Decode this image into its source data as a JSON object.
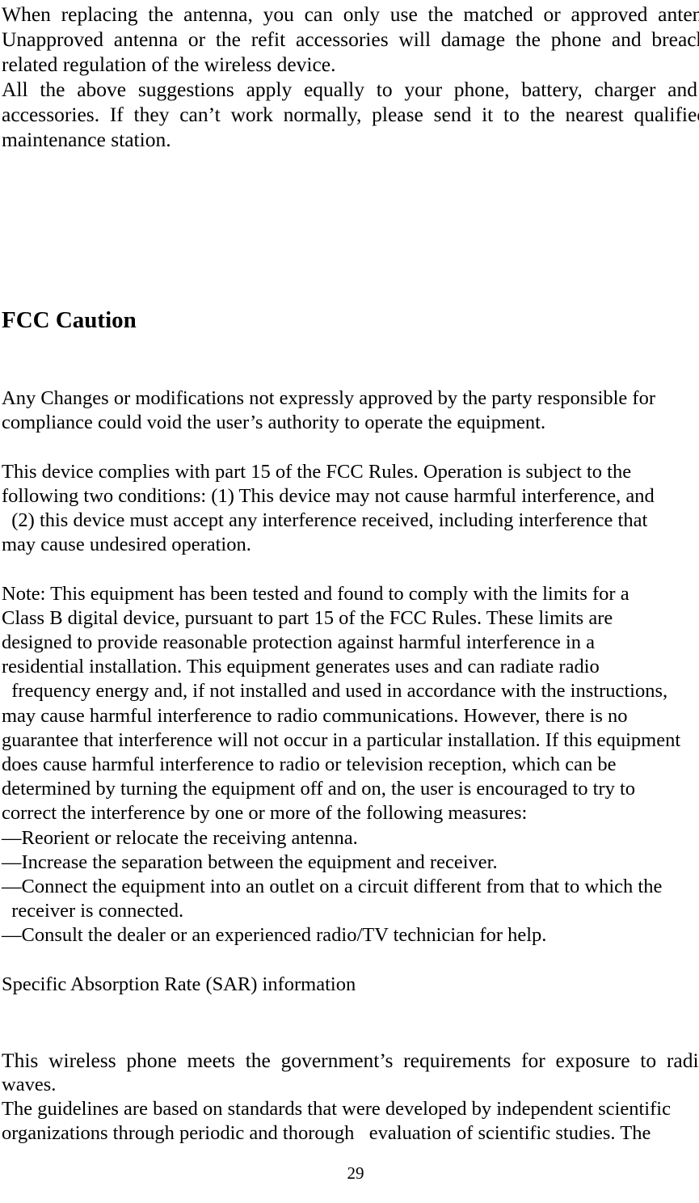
{
  "document": {
    "page_number": "29",
    "intro_paragraph": {
      "lines": [
        "When  replacing  the  antenna,  you  can  only  use  the  matched  or  approved  antenna.",
        "Unapproved  antenna  or  the  refit  accessories  will  damage  the  phone  and  breach  the",
        "related regulation of the wireless device.",
        "All  the  above  suggestions  apply  equally  to  your  phone,  battery,  charger  and",
        "accessories.  If  they  can’t  work  normally,  please  send  it  to  the  nearest  qualified",
        "maintenance station."
      ]
    },
    "heading": "FCC Caution",
    "body": {
      "lines": [
        "Any Changes or modifications not expressly approved by the party responsible for",
        "compliance could void the user’s authority to operate the equipment.",
        "",
        "This device complies with part 15 of the FCC Rules. Operation is subject to the",
        "following two conditions: (1) This device may not cause harmful interference, and",
        "  (2) this device must accept any interference received, including interference that",
        "may cause undesired operation.",
        "",
        "Note: This equipment has been tested and found to comply with the limits for a",
        "Class B digital device, pursuant to part 15 of the FCC Rules. These limits are",
        "designed to provide reasonable protection against harmful interference in a",
        "residential installation. This equipment generates uses and can radiate radio",
        "  frequency energy and, if not installed and used in accordance with the instructions,",
        "may cause harmful interference to radio communications. However, there is no",
        "guarantee that interference will not occur in a particular installation. If this equipment",
        "does cause harmful interference to radio or television reception, which can be",
        "determined by turning the equipment off and on, the user is encouraged to try to",
        "correct the interference by one or more of the following measures:",
        "—Reorient or relocate the receiving antenna.",
        "—Increase the separation between the equipment and receiver.",
        "—Connect the equipment into an outlet on a circuit different from that to which the",
        "  receiver is connected.",
        "—Consult the dealer or an experienced radio/TV technician for help.",
        "",
        "Specific Absorption Rate (SAR) information"
      ]
    },
    "sar_paragraph": {
      "line_justified": "This  wireless  phone  meets  the  government’s  requirements  for  exposure  to  radio",
      "line_waves": "waves.",
      "line_guidelines": "The guidelines are based on standards that were developed by independent scientific",
      "line_organizations": "organizations through periodic and thorough   evaluation of scientific studies. The"
    }
  }
}
